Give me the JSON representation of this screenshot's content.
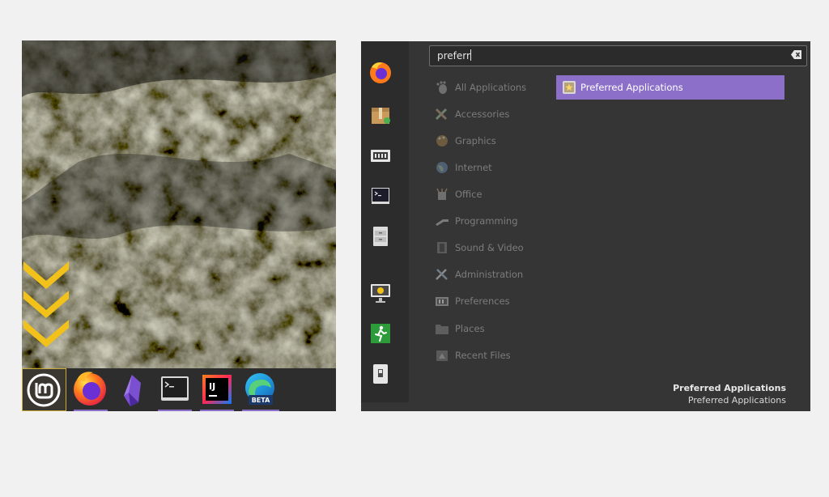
{
  "taskbar": {
    "items": [
      {
        "name": "menu-button",
        "icon": "linux-mint-logo-icon",
        "active": true
      },
      {
        "name": "firefox",
        "icon": "firefox-icon",
        "running": true
      },
      {
        "name": "obsidian",
        "icon": "obsidian-icon",
        "running": false
      },
      {
        "name": "terminal",
        "icon": "terminal-icon",
        "running": true
      },
      {
        "name": "intellij",
        "icon": "intellij-icon",
        "running": true,
        "label": "IJ"
      },
      {
        "name": "edge-beta",
        "icon": "edge-beta-icon",
        "running": true,
        "badge": "BETA"
      }
    ]
  },
  "search": {
    "value": "preferr"
  },
  "favorites": [
    "firefox-icon",
    "archive-manager-icon",
    "system-settings-icon",
    "terminal-icon",
    "file-cabinet-icon",
    "lock-screen-icon",
    "logout-icon",
    "shutdown-icon"
  ],
  "categories": [
    {
      "label": "All Applications",
      "icon": "gnome-foot-icon"
    },
    {
      "label": "Accessories",
      "icon": "accessories-icon"
    },
    {
      "label": "Graphics",
      "icon": "graphics-palette-icon"
    },
    {
      "label": "Internet",
      "icon": "globe-icon"
    },
    {
      "label": "Office",
      "icon": "office-icon"
    },
    {
      "label": "Programming",
      "icon": "programming-icon"
    },
    {
      "label": "Sound & Video",
      "icon": "film-icon"
    },
    {
      "label": "Administration",
      "icon": "tools-icon"
    },
    {
      "label": "Preferences",
      "icon": "preferences-icon"
    },
    {
      "label": "Places",
      "icon": "folder-icon"
    },
    {
      "label": "Recent Files",
      "icon": "recent-files-icon"
    }
  ],
  "results": [
    {
      "label": "Preferred Applications",
      "icon": "preferred-applications-icon"
    }
  ],
  "description": {
    "title": "Preferred Applications",
    "subtitle": "Preferred Applications"
  },
  "colors": {
    "accent": "#8b6fc9",
    "arrow": "#f2c21a",
    "menu_bg": "#353535",
    "favbar_bg": "#2c2c2c",
    "page_bg": "#f1f1f1"
  }
}
